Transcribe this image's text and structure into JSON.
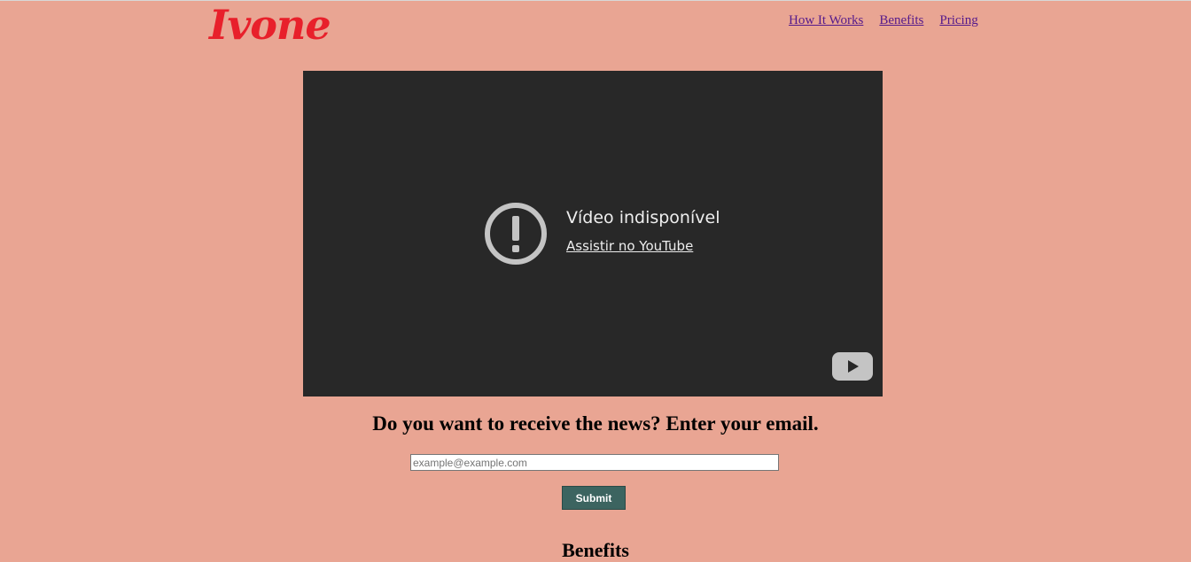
{
  "header": {
    "logo_text": "Ivone",
    "nav": [
      {
        "label": "How It Works"
      },
      {
        "label": "Benefits"
      },
      {
        "label": "Pricing"
      }
    ]
  },
  "video": {
    "message": "Vídeo indisponível",
    "link_label": "Assistir no YouTube",
    "icons": [
      "alert-circle-icon",
      "youtube-play-icon"
    ]
  },
  "newsletter": {
    "heading": "Do you want to receive the news? Enter your email.",
    "email_placeholder": "example@example.com",
    "email_value": "",
    "submit_label": "Submit"
  },
  "section": {
    "benefits_heading": "Benefits"
  },
  "colors": {
    "background": "#e9a593",
    "logo": "#e8202b",
    "video_bg": "#282828",
    "button": "#3c6460",
    "link": "#551a8b"
  }
}
